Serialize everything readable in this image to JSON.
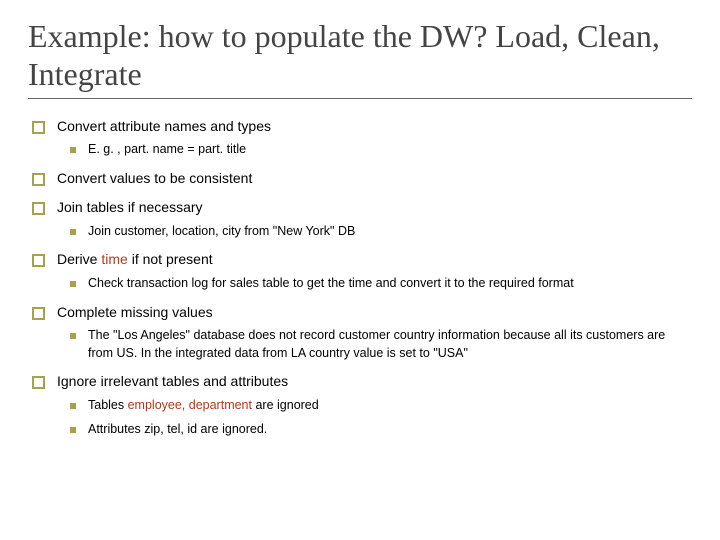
{
  "title": "Example: how to populate the DW? Load, Clean, Integrate",
  "items": [
    {
      "text": "Convert attribute names and types",
      "sub": [
        {
          "text": "E. g. , part. name = part. title"
        }
      ]
    },
    {
      "text": "Convert values to be consistent",
      "sub": []
    },
    {
      "text": "Join tables if necessary",
      "sub": [
        {
          "text": "Join customer, location, city from \"New York\" DB"
        }
      ]
    },
    {
      "pre": "Derive ",
      "em": "time",
      "post": " if not present",
      "sub": [
        {
          "text": "Check transaction log for sales table to get the time and convert it to the required format"
        }
      ]
    },
    {
      "text": "Complete missing values",
      "sub": [
        {
          "text": "The \"Los Angeles\" database does not record customer country information because all its customers are from US. In the integrated data from LA country value is set to \"USA\""
        }
      ]
    },
    {
      "text": "Ignore irrelevant tables and attributes",
      "sub": [
        {
          "pre": "Tables ",
          "em": "employee, department",
          "post": " are ignored"
        },
        {
          "text": "Attributes zip, tel, id are ignored."
        }
      ]
    }
  ]
}
